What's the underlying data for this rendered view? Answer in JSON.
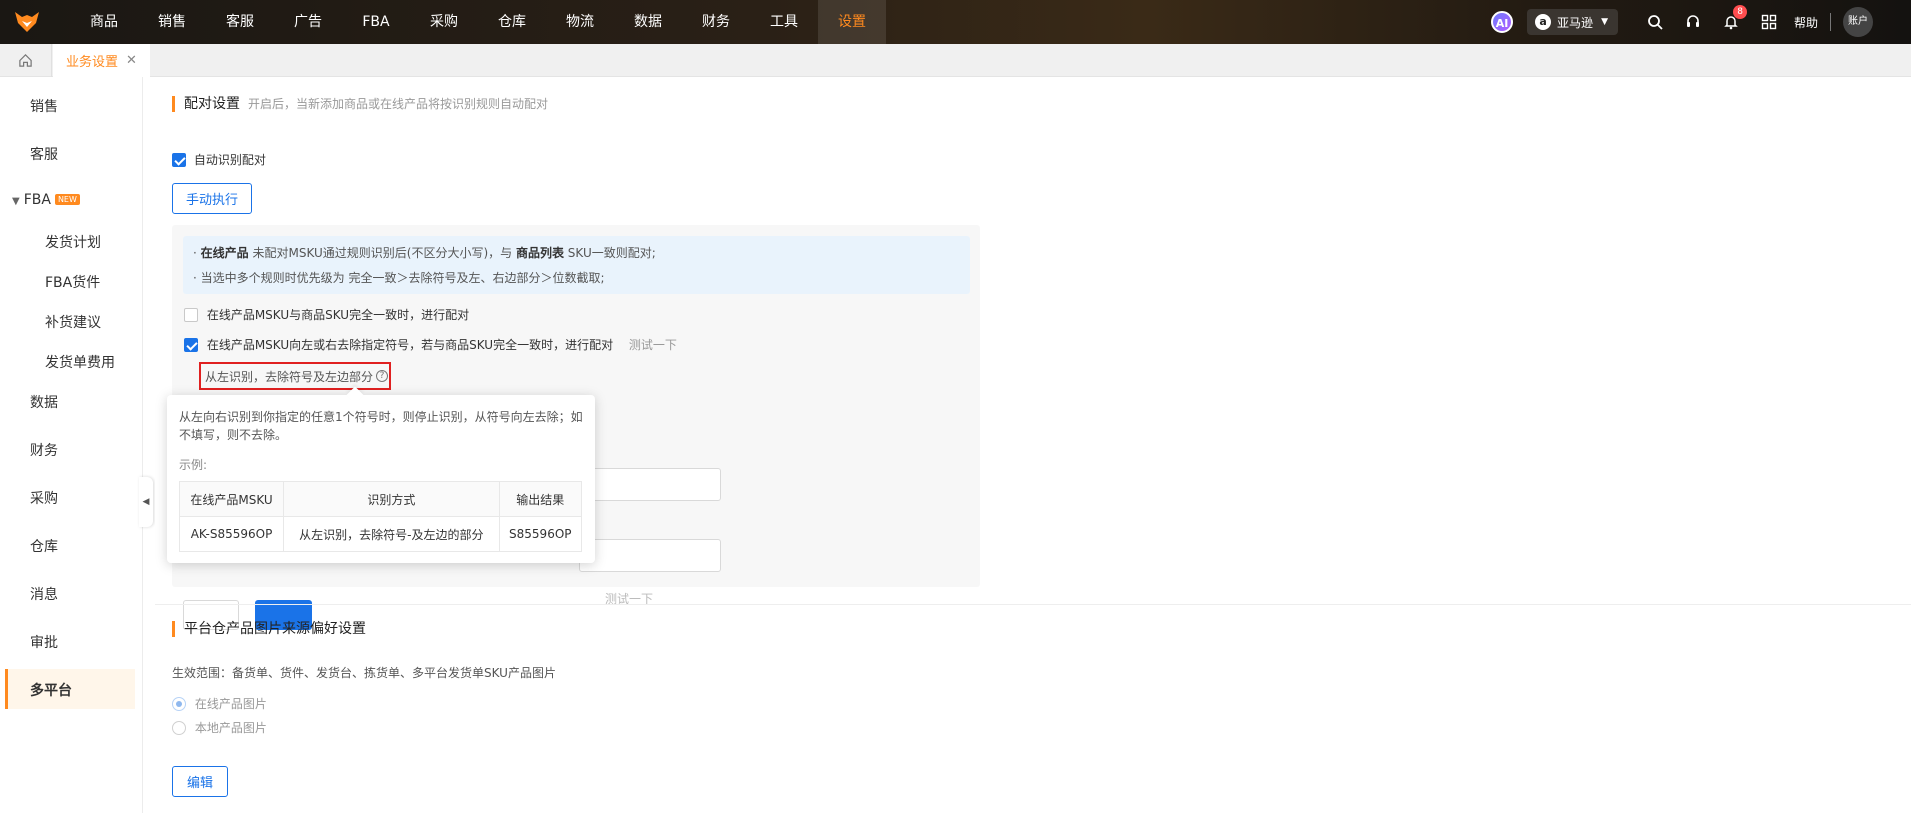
{
  "topbar": {
    "nav": [
      "商品",
      "销售",
      "客服",
      "广告",
      "FBA",
      "采购",
      "仓库",
      "物流",
      "数据",
      "财务",
      "工具",
      "设置"
    ],
    "active_nav": "设置",
    "ai_label": "AI",
    "market_label": "亚马逊",
    "notification_count": "8",
    "help_label": "帮助",
    "account_label": "账户",
    "accent_color": "#ff8a1f"
  },
  "tabs": {
    "current": "业务设置"
  },
  "sidebar": {
    "items": {
      "sales": "销售",
      "service": "客服",
      "fba": "FBA",
      "fba_new": "NEW",
      "fba_plan": "发货计划",
      "fba_goods": "FBA货件",
      "fba_restock": "补货建议",
      "fba_fee": "发货单费用",
      "data": "数据",
      "finance": "财务",
      "purchase": "采购",
      "warehouse": "仓库",
      "message": "消息",
      "approval": "审批",
      "multi": "多平台"
    },
    "active": "多平台"
  },
  "pairing": {
    "title": "配对设置",
    "subtitle": "开启后，当新添加商品或在线产品将按识别规则自动配对",
    "auto_label": "自动识别配对",
    "manual_button": "手动执行",
    "info_line1_prefix": "· ",
    "info_line1_b1": "在线产品",
    "info_line1_mid": " 未配对MSKU通过规则识别后(不区分大小写)，与 ",
    "info_line1_b2": "商品列表",
    "info_line1_suffix": " SKU一致则配对;",
    "info_line2": "· 当选中多个规则时优先级为 完全一致＞去除符号及左、右边部分＞位数截取;",
    "rule1": "在线产品MSKU与商品SKU完全一致时，进行配对",
    "rule2": "在线产品MSKU向左或右去除指定符号，若与商品SKU完全一致时，进行配对",
    "test_link": "测试一下",
    "test_link_faint": "测试一下",
    "left_rule": "从左识别，去除符号及左边部分",
    "help_mark": "?"
  },
  "tooltip": {
    "desc": "从左向右识别到你指定的任意1个符号时，则停止识别，从符号向左去除；如不填写，则不去除。",
    "example_label": "示例:",
    "headers": [
      "在线产品MSKU",
      "识别方式",
      "输出结果"
    ],
    "row": [
      "AK-S85596OP",
      "从左识别，去除符号-及左边的部分",
      "S85596OP"
    ]
  },
  "image_pref": {
    "title": "平台仓产品图片来源偏好设置",
    "scope": "生效范围：备货单、货件、发货台、拣货单、多平台发货单SKU产品图片",
    "option1": "在线产品图片",
    "option2": "本地产品图片",
    "edit_button": "编辑"
  }
}
